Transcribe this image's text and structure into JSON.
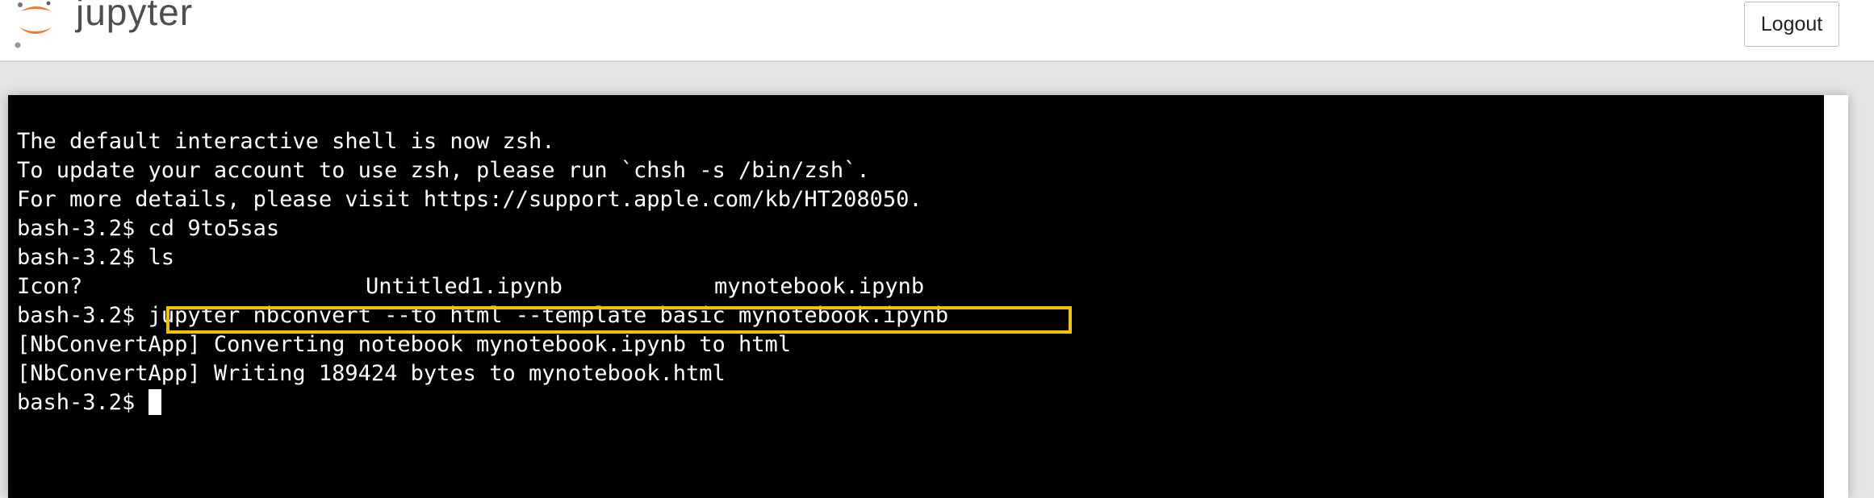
{
  "header": {
    "logo_text": "jupyter",
    "logout_label": "Logout"
  },
  "colors": {
    "logo_orange": "#f37726",
    "highlight": "#f2c200",
    "terminal_bg": "#000000",
    "terminal_fg": "#ffffff"
  },
  "terminal": {
    "lines": [
      "The default interactive shell is now zsh.",
      "To update your account to use zsh, please run `chsh -s /bin/zsh`.",
      "For more details, please visit https://support.apple.com/kb/HT208050.",
      "bash-3.2$ cd 9to5sas",
      "bash-3.2$ ls"
    ],
    "ls_output": [
      "Icon?",
      "Untitled1.ipynb",
      "mynotebook.ipynb"
    ],
    "prompt": "bash-3.2$ ",
    "highlighted_command": "jupyter nbconvert --to html --template basic mynotebook.ipynb",
    "output_lines": [
      "[NbConvertApp] Converting notebook mynotebook.ipynb to html",
      "[NbConvertApp] Writing 189424 bytes to mynotebook.html"
    ],
    "final_prompt": "bash-3.2$ "
  }
}
